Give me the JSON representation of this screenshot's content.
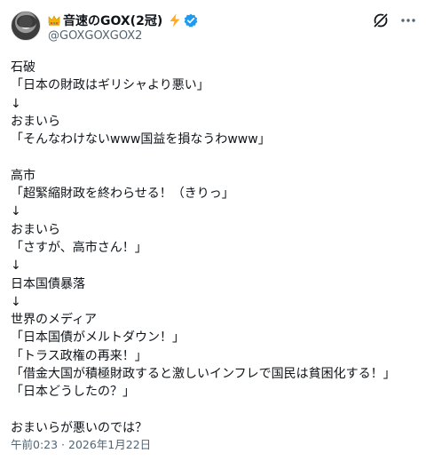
{
  "author": {
    "display_name": "音速のGOX(2冠)",
    "handle": "@GOXGOXGOX2",
    "icons": [
      "crown-icon",
      "lightning-icon",
      "verified-icon"
    ]
  },
  "header_actions": {
    "icons": [
      "grok-icon",
      "more-icon"
    ]
  },
  "tweet": {
    "lines": [
      "石破",
      "「日本の財政はギリシャより悪い」",
      "↓",
      "おまいら",
      "「そんなわけないwww国益を損なうわwww」",
      "",
      "高市",
      "「超緊縮財政を終わらせる！（きりっ」",
      "↓",
      "おまいら",
      "「さすが、高市さん！」",
      "↓",
      "日本国債暴落",
      "↓",
      "世界のメディア",
      "「日本国債がメルトダウン！」",
      "「トラス政権の再来！」",
      "「借金大国が積極財政すると激しいインフレで国民は貧困化する！」",
      "「日本どうしたの？」",
      "",
      "おまいらが悪いのでは？"
    ],
    "timestamp": "午前0:23 · 2026年1月22日"
  },
  "colors": {
    "text": "#0f1419",
    "secondary": "#536471",
    "verified": "#1d9bf0",
    "lightning": "#ffad1f",
    "crown": "#f4b400"
  }
}
